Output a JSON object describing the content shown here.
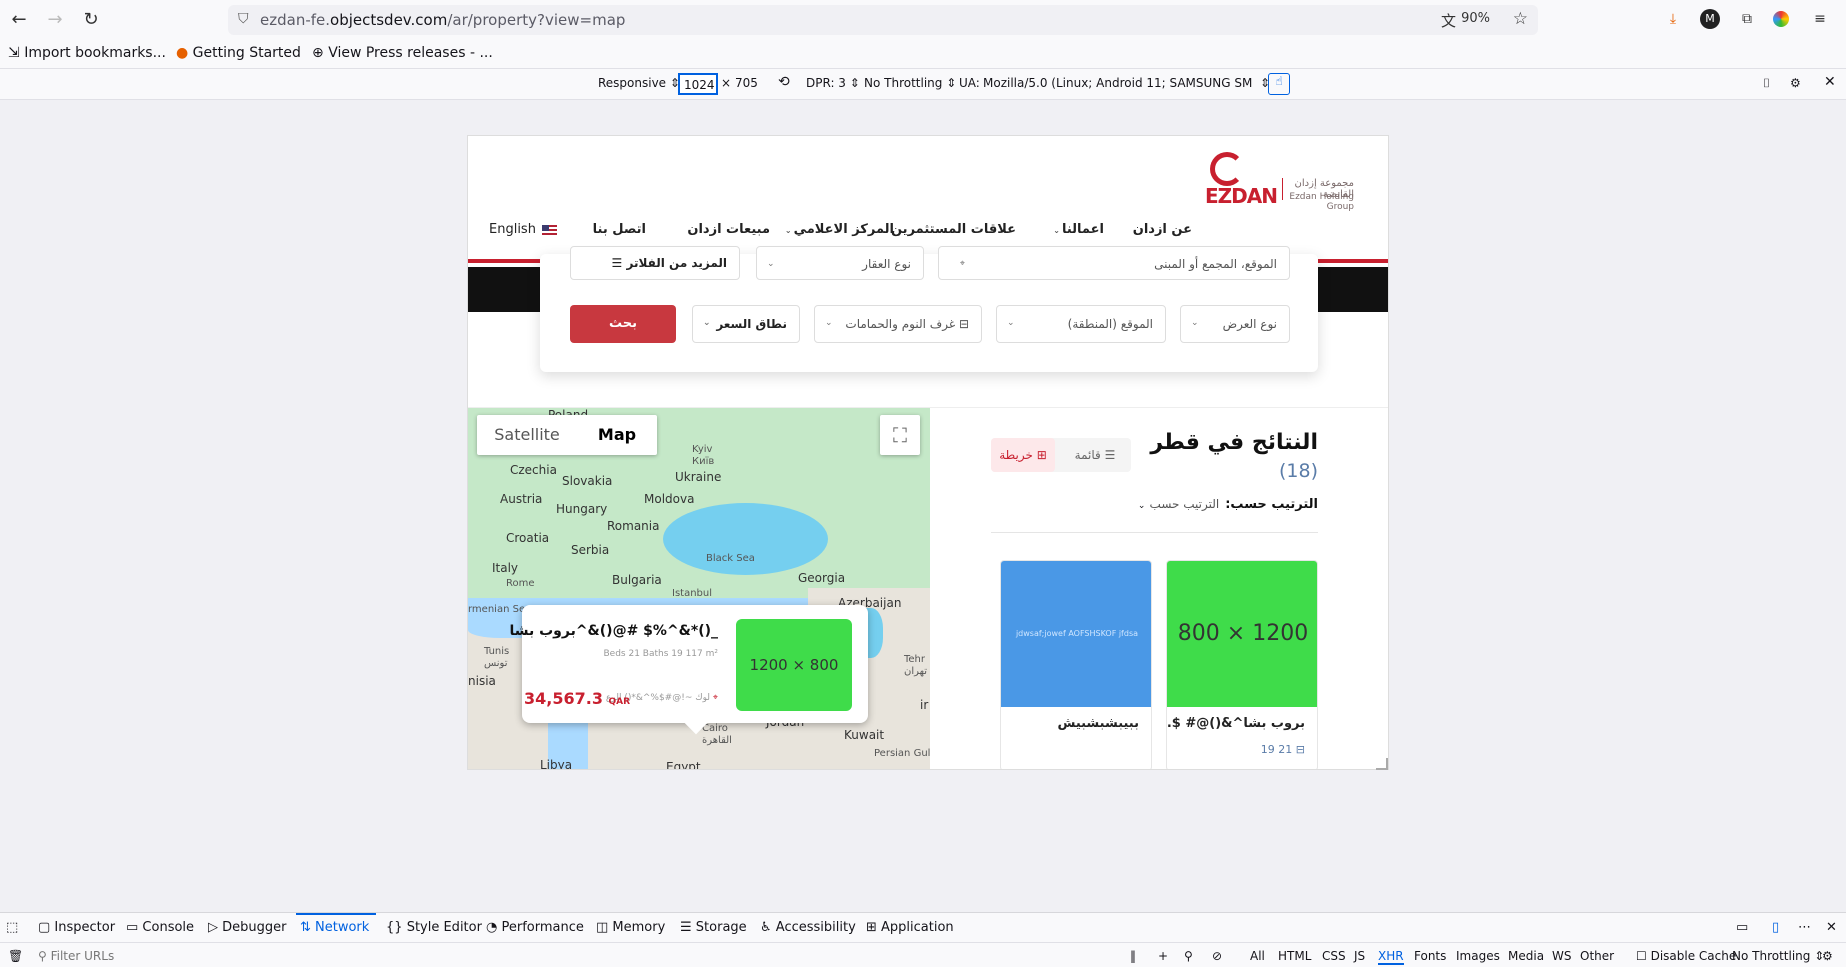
{
  "browser": {
    "url_prefix": "ezdan-fe.",
    "url_domain": "objectsdev.com",
    "url_path": "/ar/property?view=map",
    "zoom": "90%",
    "bookmarks": [
      "Import bookmarks...",
      "Getting Started",
      "View Press releases - ..."
    ]
  },
  "rdm": {
    "device": "Responsive",
    "width": "1024",
    "height": "705",
    "dpr": "DPR: 3",
    "throttling": "No Throttling",
    "ua_label": "UA:",
    "ua_value": "Mozilla/5.0 (Linux; Android 11; SAMSUNG SM"
  },
  "site": {
    "logo_text": "EZDAN",
    "logo_ar": "مجموعة إزدان القابضة",
    "logo_en": "Ezdan Holding Group",
    "nav": [
      "عن ازدان",
      "اعمالنا",
      "علاقات المستثمرين",
      "المركز الاعلامي",
      "مبيعات ازدان",
      "اتصل بنا"
    ],
    "lang": "English"
  },
  "search": {
    "location_placeholder": "الموقع، المجمع أو المبنى",
    "property_type": "نوع العقار",
    "more_filters": "المزيد من الفلاتر",
    "offer_type": "نوع العرض",
    "area": "الموقع (المنطقة)",
    "rooms": "غرف النوم والحمامات",
    "price_range": "نطاق السعر",
    "search_button": "بحث"
  },
  "map": {
    "satellite": "Satellite",
    "map": "Map",
    "labels": [
      "Poland",
      "Czechia",
      "Slovakia",
      "Ukraine",
      "Kyiv",
      "Київ",
      "Austria",
      "Hungary",
      "Moldova",
      "Croatia",
      "Romania",
      "Serbia",
      "Black Sea",
      "Georgia",
      "Italy",
      "Bulgaria",
      "Rome",
      "Istanbul",
      "Azerbaijan",
      "Cairo",
      "القاهرة",
      "Jordan",
      "Kuwait",
      "Libya",
      "Egypt",
      "Persian Gul",
      "Tehr",
      "تهران",
      "ir",
      "rmenian Sea",
      "nisia",
      "Tunis",
      "تونس"
    ],
    "popup": {
      "image_label": "1200 × 800",
      "title": "بروب بشا^&()@# $%^&*()_",
      "meta": "Beds 21   Baths 19   117 m²",
      "location": "لوك ~!@#$%^&*() الرع",
      "price": "34,567.3",
      "currency": "QAR"
    }
  },
  "results": {
    "title": "النتائج في قطر",
    "count": "(18)",
    "list_view": "قائمة",
    "map_view": "خريطة",
    "sort_label": "الترتيب حسب:",
    "sort_value": "الترتيب حسب",
    "cards": [
      {
        "image_label": "1200 × 800",
        "title": "بروب بشا^&()@# $...",
        "meta": "21   19"
      },
      {
        "image_label": "jdwsaf;jowef AOFSHSKOF jfdsa 1200×800",
        "title": "ببيبشبشبيش",
        "meta": ""
      }
    ]
  },
  "devtools": {
    "tabs": [
      "Inspector",
      "Console",
      "Debugger",
      "Network",
      "Style Editor",
      "Performance",
      "Memory",
      "Storage",
      "Accessibility",
      "Application"
    ],
    "active_tab": "Network",
    "filter_placeholder": "Filter URLs",
    "filters": [
      "All",
      "HTML",
      "CSS",
      "JS",
      "XHR",
      "Fonts",
      "Images",
      "Media",
      "WS",
      "Other"
    ],
    "disable_cache": "Disable Cache",
    "throttling": "No Throttling"
  },
  "colors": {
    "brand_red": "#c8202f",
    "search_button": "#c8383f",
    "link_blue": "#0061e0"
  }
}
